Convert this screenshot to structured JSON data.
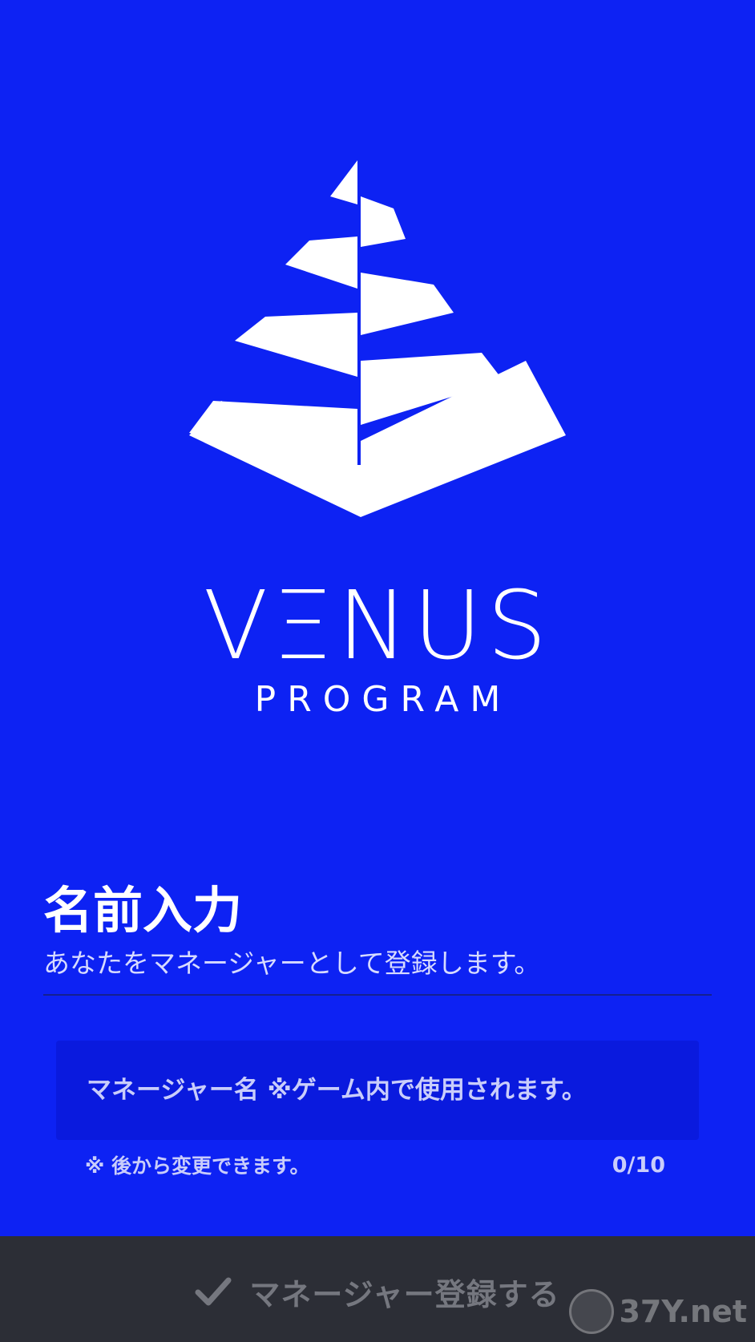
{
  "colors": {
    "background": "#0d22f3",
    "field_background": "#0a1ade",
    "bottom_bar": "#2c2e36",
    "disabled_text": "#75777f",
    "text": "#ffffff"
  },
  "brand": {
    "logo_icon": "pyramid-logo",
    "name": "VΞNUS",
    "subtitle": "PROGRAM"
  },
  "form": {
    "title": "名前入力",
    "description": "あなたをマネージャーとして登録します。",
    "name_input": {
      "value": "",
      "placeholder": "マネージャー名 ※ゲーム内で使用されます。"
    },
    "hint": "※ 後から変更できます。",
    "counter": "0/10"
  },
  "action": {
    "icon": "check-icon",
    "label": "マネージャー登録する",
    "enabled": false
  },
  "watermark": {
    "text": "37Y.net"
  }
}
